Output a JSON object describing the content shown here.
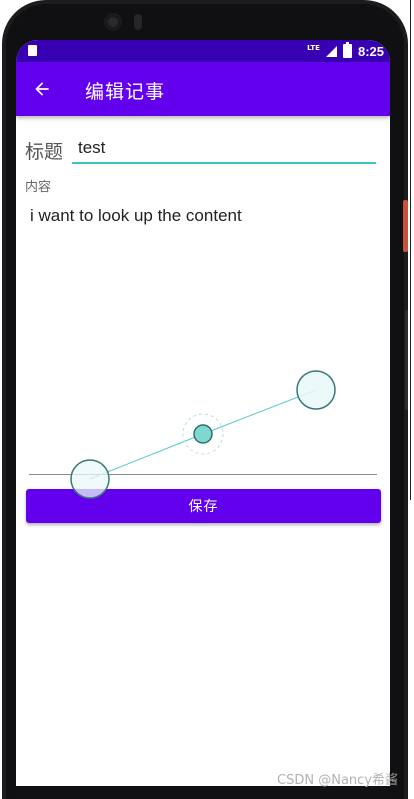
{
  "status_bar": {
    "network": "LTE",
    "time": "8:25"
  },
  "app_bar": {
    "back_icon": "arrow-left-icon",
    "title": "编辑记事"
  },
  "form": {
    "title_label": "标题",
    "title_value": "test",
    "content_label": "内容",
    "content_value": "i want to look up the content",
    "save_label": "保存"
  },
  "watermark": "CSDN @Nancy希酱",
  "colors": {
    "status_bar": "#3700b3",
    "app_bar": "#6200ee",
    "accent": "#3fc1c0",
    "button": "#6200ee"
  }
}
